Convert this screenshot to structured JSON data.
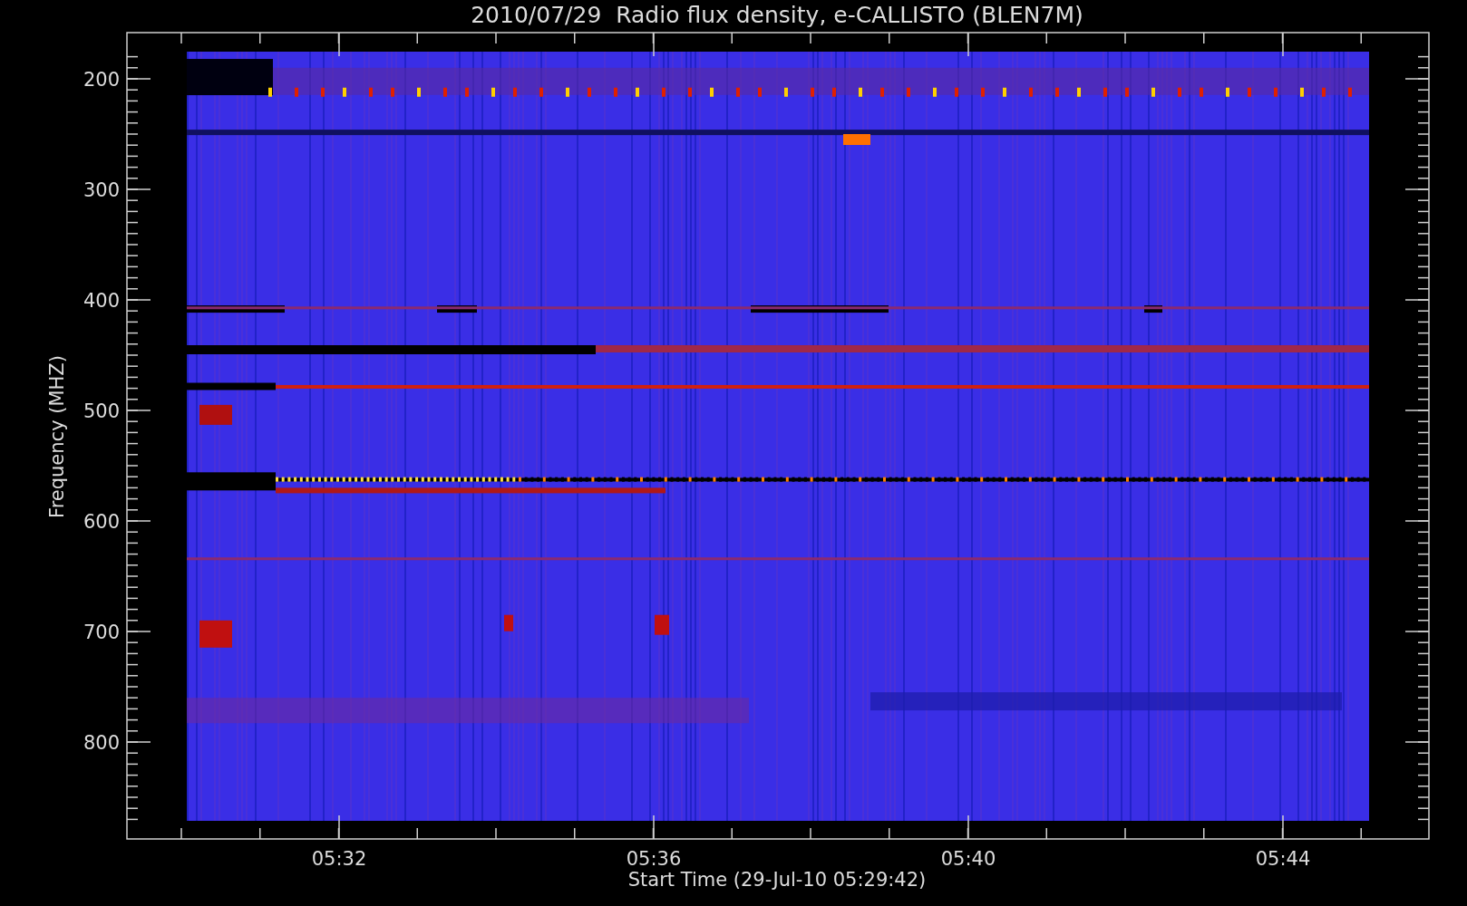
{
  "title": "2010/07/29  Radio flux density, e-CALLISTO (BLEN7M)",
  "y_axis": {
    "label": "Frequency (MHZ)",
    "ticks": [
      "200",
      "300",
      "400",
      "500",
      "600",
      "700",
      "800"
    ]
  },
  "x_axis": {
    "label": "Start Time (29-Jul-10 05:29:42)",
    "ticks": [
      "05:32",
      "05:36",
      "05:40",
      "05:44"
    ]
  }
}
